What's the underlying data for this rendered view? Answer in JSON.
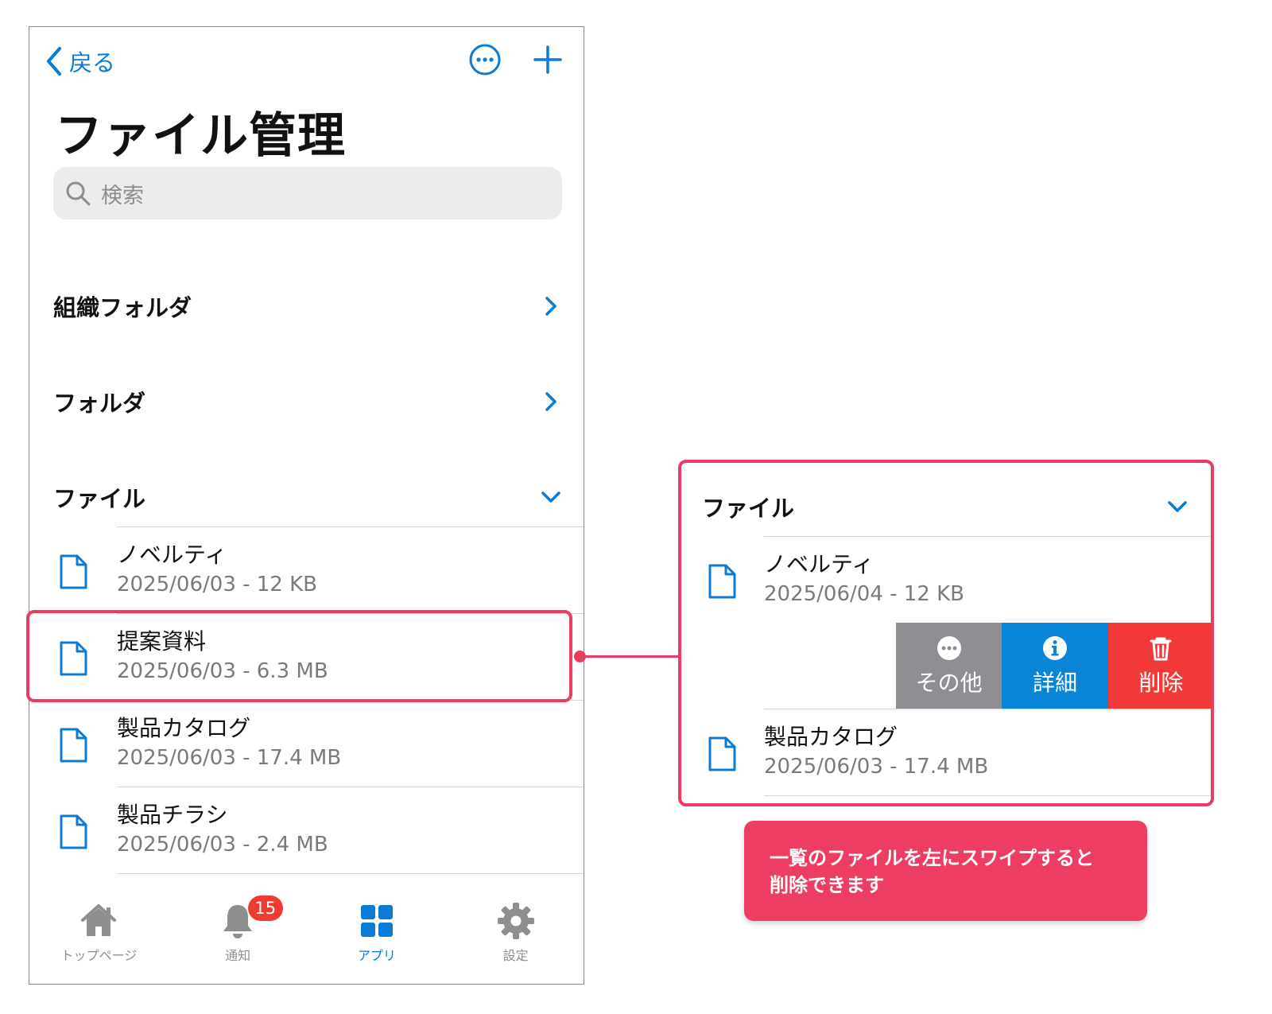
{
  "nav": {
    "back_label": "戻る",
    "more_icon": "ellipsis-circle-icon",
    "add_icon": "plus-icon"
  },
  "page": {
    "title": "ファイル管理"
  },
  "search": {
    "placeholder": "検索"
  },
  "sections": {
    "org_folder": "組織フォルダ",
    "folder": "フォルダ",
    "files": "ファイル"
  },
  "files": [
    {
      "name": "ノベルティ",
      "meta": "2025/06/03 - 12 KB"
    },
    {
      "name": "提案資料",
      "meta": "2025/06/03 - 6.3 MB"
    },
    {
      "name": "製品カタログ",
      "meta": "2025/06/03 - 17.4 MB"
    },
    {
      "name": "製品チラシ",
      "meta": "2025/06/03 - 2.4 MB"
    }
  ],
  "tabbar": {
    "tabs": [
      {
        "label": "トップページ",
        "icon": "home-icon"
      },
      {
        "label": "通知",
        "icon": "bell-icon",
        "badge": "15"
      },
      {
        "label": "アプリ",
        "icon": "apps-grid-icon",
        "active": true
      },
      {
        "label": "設定",
        "icon": "gear-icon"
      }
    ]
  },
  "zoom": {
    "section": "ファイル",
    "rows": [
      {
        "name": "ノベルティ",
        "meta": "2025/06/04 - 12 KB"
      },
      {
        "name": "製品カタログ",
        "meta": "2025/06/03 - 17.4 MB"
      }
    ],
    "actions": {
      "more": "その他",
      "detail": "詳細",
      "delete": "削除"
    }
  },
  "callout": {
    "line1": "一覧のファイルを左にスワイプすると",
    "line2": "削除できます"
  },
  "colors": {
    "accent_blue": "#0a7bd6",
    "highlight_pink": "#e83c62",
    "delete_red": "#f2393a",
    "more_gray": "#8e8e93",
    "badge_red": "#f13b30"
  }
}
